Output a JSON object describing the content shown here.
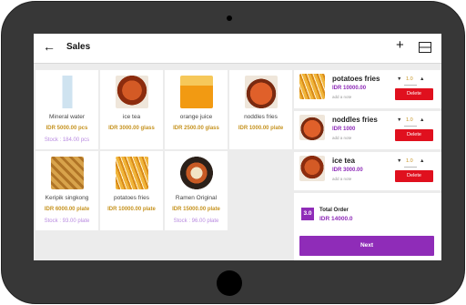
{
  "header": {
    "title": "Sales",
    "back_icon": "arrow-left-icon",
    "add_icon": "plus-icon",
    "scan_icon": "barcode-scan-icon"
  },
  "products": [
    {
      "name": "Mineral water",
      "price": "IDR 5000.00 pcs",
      "stock": "Stock : 184.00 pcs",
      "image": "water-bottle-image",
      "color": "#dfe9ef"
    },
    {
      "name": "ice tea",
      "price": "IDR 3000.00 glass",
      "stock": "",
      "image": "ice-tea-image",
      "color": "#b53a17"
    },
    {
      "name": "orange juice",
      "price": "IDR 2500.00 glass",
      "stock": "",
      "image": "orange-juice-image",
      "color": "#f29a12"
    },
    {
      "name": "noddles fries",
      "price": "IDR 1000.00 plate",
      "stock": "",
      "image": "noodles-image",
      "color": "#c7401c"
    },
    {
      "name": "Keripik singkong",
      "price": "IDR 6000.00 plate",
      "stock": "Stock : 93.00 plate",
      "image": "cassava-chips-image",
      "color": "#c58a33"
    },
    {
      "name": "potatoes fries",
      "price": "IDR 10000.00 plate",
      "stock": "",
      "image": "fries-image",
      "color": "#e7a62c"
    },
    {
      "name": "Ramen Original",
      "price": "IDR 15000.00 plate",
      "stock": "Stock : 96.00 plate",
      "image": "ramen-image",
      "color": "#3a2a22"
    }
  ],
  "order": {
    "items": [
      {
        "name": "potatoes fries",
        "price": "IDR 10000.00",
        "note": "add a note",
        "qty": "1.0",
        "delete_label": "Delete",
        "image": "fries-image",
        "color": "#e7a62c"
      },
      {
        "name": "noddles fries",
        "price": "IDR 1000",
        "note": "add a note",
        "qty": "1.0",
        "delete_label": "Delete",
        "image": "noodles-image",
        "color": "#c7401c"
      },
      {
        "name": "ice tea",
        "price": "IDR 3000.00",
        "note": "add a note",
        "qty": "1.0",
        "delete_label": "Delete",
        "image": "ice-tea-image",
        "color": "#b53a17"
      }
    ],
    "count": "3.0",
    "total_label": "Total Order",
    "total_value": "IDR 14000.0",
    "next_label": "Next"
  }
}
